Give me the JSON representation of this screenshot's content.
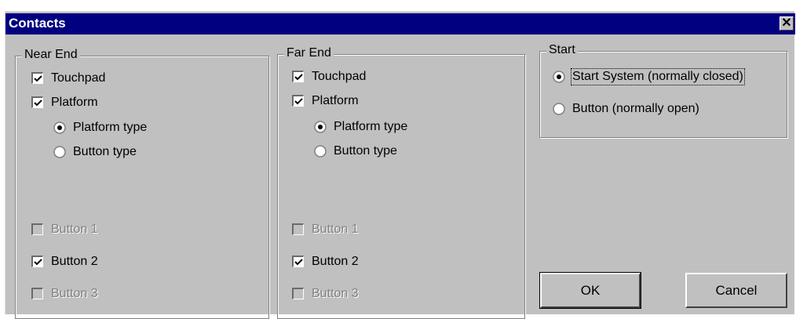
{
  "window": {
    "title": "Contacts",
    "close_icon": "close-icon"
  },
  "near_end": {
    "legend": "Near End",
    "touchpad": {
      "label": "Touchpad",
      "checked": true
    },
    "platform": {
      "label": "Platform",
      "checked": true
    },
    "platform_type": {
      "label": "Platform type",
      "selected": true
    },
    "button_type": {
      "label": "Button  type",
      "selected": false
    },
    "button1": {
      "label": "Button 1",
      "checked": false,
      "enabled": false
    },
    "button2": {
      "label": "Button 2",
      "checked": true,
      "enabled": true
    },
    "button3": {
      "label": "Button 3",
      "checked": false,
      "enabled": false
    }
  },
  "far_end": {
    "legend": "Far End",
    "touchpad": {
      "label": "Touchpad",
      "checked": true
    },
    "platform": {
      "label": "Platform",
      "checked": true
    },
    "platform_type": {
      "label": "Platform type",
      "selected": true
    },
    "button_type": {
      "label": "Button  type",
      "selected": false
    },
    "button1": {
      "label": "Button 1",
      "checked": false,
      "enabled": false
    },
    "button2": {
      "label": "Button 2",
      "checked": true,
      "enabled": true
    },
    "button3": {
      "label": "Button 3",
      "checked": false,
      "enabled": false
    }
  },
  "start": {
    "legend": "Start",
    "start_system": {
      "label": "Start System (normally closed)",
      "selected": true
    },
    "button_open": {
      "label": "Button (normally open)",
      "selected": false
    }
  },
  "buttons": {
    "ok": "OK",
    "cancel": "Cancel"
  },
  "colors": {
    "titlebar": "#000080",
    "face": "#c0c0c0",
    "disabled_text": "#808080"
  }
}
